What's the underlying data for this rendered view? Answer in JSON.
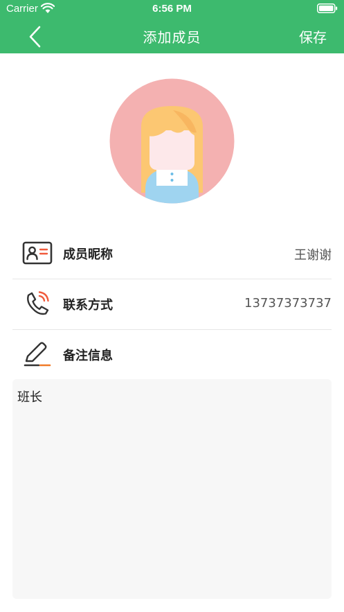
{
  "status_bar": {
    "carrier": "Carrier",
    "time": "6:56 PM"
  },
  "nav": {
    "title": "添加成员",
    "save_label": "保存"
  },
  "colors": {
    "header_bg": "#3dba6e",
    "avatar_bg": "#f4b1b1",
    "accent_red": "#f05a3c",
    "accent_orange": "#f07a28"
  },
  "avatar": {
    "icon": "girl-avatar-icon"
  },
  "fields": {
    "nickname": {
      "icon": "id-card-icon",
      "label": "成员昵称",
      "value": "王谢谢"
    },
    "contact": {
      "icon": "phone-icon",
      "label": "联系方式",
      "value": "13737373737"
    },
    "remark": {
      "icon": "edit-pen-icon",
      "label": "备注信息",
      "value": "班长"
    }
  }
}
